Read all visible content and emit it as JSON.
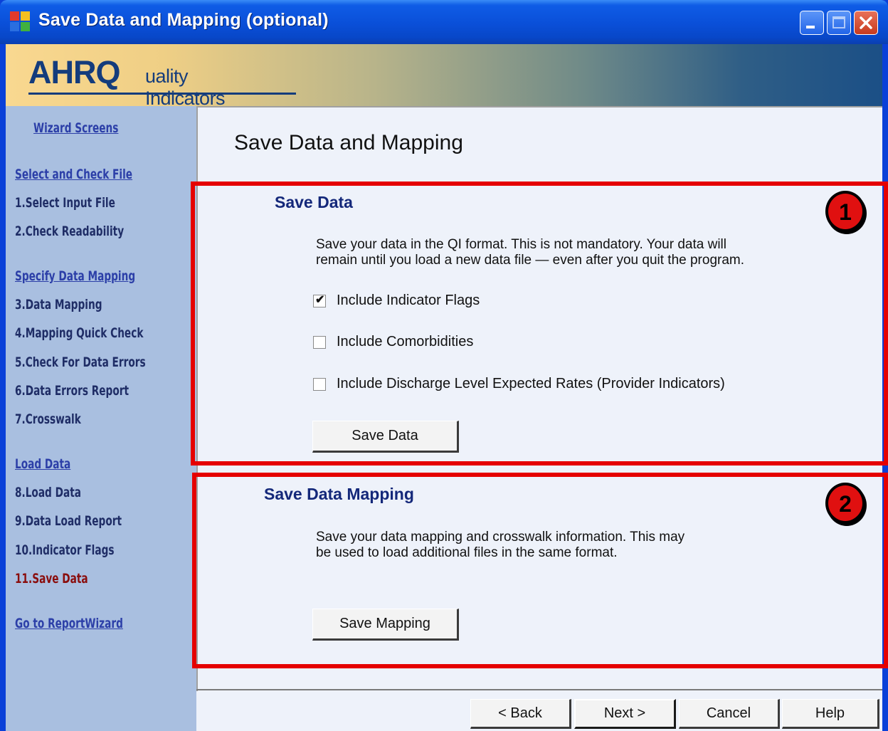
{
  "window": {
    "title": "Save Data and Mapping (optional)"
  },
  "banner": {
    "logo_main": "AHRQ",
    "logo_sub": "uality Indicators"
  },
  "sidebar": {
    "header": "Wizard Screens",
    "groups": [
      {
        "label": "Select and Check File",
        "items": [
          "1.Select Input File",
          "2.Check Readability"
        ]
      },
      {
        "label": "Specify Data Mapping",
        "items": [
          "3.Data Mapping",
          "4.Mapping Quick Check",
          "5.Check For Data Errors",
          "6.Data Errors Report",
          "7.Crosswalk"
        ]
      },
      {
        "label": "Load Data",
        "items": [
          "8.Load Data",
          "9.Data Load Report",
          "10.Indicator Flags",
          "11.Save Data"
        ]
      }
    ],
    "current_item": "11.Save Data",
    "report_wizard_link": "Go to ReportWizard"
  },
  "main": {
    "page_title": "Save Data and Mapping",
    "save_data": {
      "badge": "1",
      "title": "Save Data",
      "desc_line1": "Save your data in the QI format.  This is not mandatory.  Your data will",
      "desc_line2": "remain until you load a new data file — even after you quit the program.",
      "options": [
        {
          "label": "Include Indicator Flags",
          "checked": true
        },
        {
          "label": "Include Comorbidities",
          "checked": false
        },
        {
          "label": "Include Discharge Level Expected Rates (Provider Indicators)",
          "checked": false
        }
      ],
      "button_label": "Save Data"
    },
    "save_mapping": {
      "badge": "2",
      "title": "Save Data Mapping",
      "desc_line1": "Save your data mapping and crosswalk information.  This may",
      "desc_line2": "be used to load additional files in the same format.",
      "button_label": "Save Mapping"
    }
  },
  "footer": {
    "back_label": "< Back",
    "next_label": "Next >",
    "cancel_label": "Cancel",
    "help_label": "Help"
  },
  "colors": {
    "titlebar": "#0a4fd8",
    "sidebar": "#a9bfe0",
    "content": "#eef2fa",
    "highlight_box": "#e50000",
    "section_title": "#14287a",
    "current_step": "#8a0d0d"
  }
}
